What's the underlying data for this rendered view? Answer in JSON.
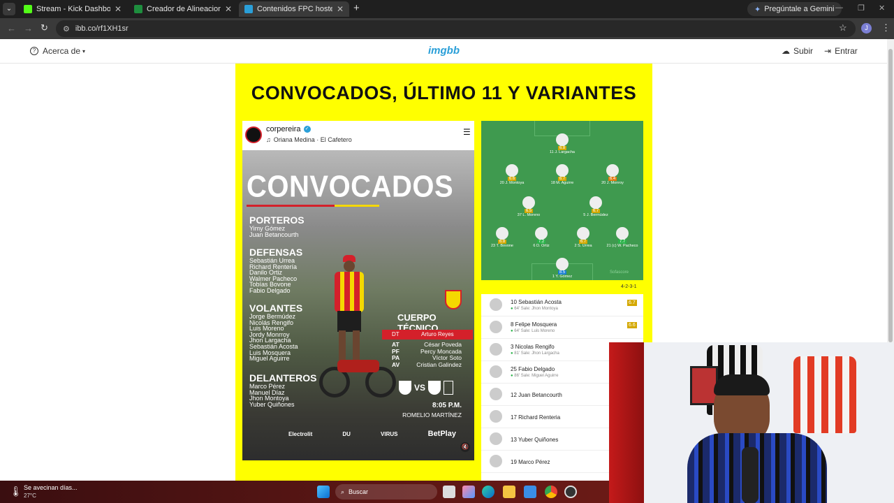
{
  "browser": {
    "tabs": [
      {
        "label": "Stream - Kick Dashboard",
        "favicon_color": "#53fc18"
      },
      {
        "label": "Creador de Alineaciones - Form",
        "favicon_color": "#1e8e3e"
      },
      {
        "label": "Contenidos FPC hosted at ImgB",
        "favicon_color": "#2a9fd8"
      }
    ],
    "gemini_label": "Pregúntale a Gemini",
    "url": "ibb.co/rf1XH1sr",
    "profile_initial": "J"
  },
  "imgbb_header": {
    "about_label": "Acerca de",
    "logo": "imgbb",
    "upload_label": "Subir",
    "login_label": "Entrar"
  },
  "poster": {
    "title": "CONVOCADOS, ÚLTIMO 11 Y VARIANTES",
    "ig": {
      "account": "corpereira",
      "music": "Oriana Medina · El Cafetero",
      "headline": "CONVOCADOS",
      "sections": [
        {
          "label": "PORTEROS",
          "players": [
            "Yimy Gómez",
            "Juan Betancourth"
          ]
        },
        {
          "label": "DEFENSAS",
          "players": [
            "Sebastián Urrea",
            "Richard Rentería",
            "Danilo Ortiz",
            "Walmer Pacheco",
            "Tobías Bovone",
            "Fabio Delgado"
          ]
        },
        {
          "label": "VOLANTES",
          "players": [
            "Jorge Bermúdez",
            "Nicolás Rengifo",
            "Luis Moreno",
            "Jordy Monrroy",
            "Jhon Largacha",
            "Sebastián Acosta",
            "Luis Mosquera",
            "Miguel Aguirre"
          ]
        },
        {
          "label": "DELANTEROS",
          "players": [
            "Marco Pérez",
            "Manuel Díaz",
            "Jhon Montoya",
            "Yuber Quiñones"
          ]
        }
      ],
      "staff": {
        "title": "CUERPO TÉCNICO",
        "dt_label": "DT",
        "dt_name": "Arturo Reyes",
        "roles": "AT\nPF\nPA\nAV",
        "names": "César Poveda\nPercy Moncada\nVíctor Soto\nCristian Galindez"
      },
      "match_vs": "VS",
      "match_time": "8:05 P.M.",
      "stadium": "ROMELIO MARTÍNEZ",
      "sponsors": [
        "Electrolit",
        "DU",
        "VIRUS",
        "BetPlay"
      ]
    },
    "formation": {
      "players": [
        {
          "name": "11 J. Largacha",
          "rating": "6.8",
          "color": "#d4a800"
        },
        {
          "name": "20 J. Montoya",
          "rating": "6.6",
          "color": "#d4a800"
        },
        {
          "name": "18 M. Aguirre",
          "rating": "6.7",
          "color": "#d4a800"
        },
        {
          "name": "20 J. Monroy",
          "rating": "6.4",
          "color": "#e07a10"
        },
        {
          "name": "37 L. Moreno",
          "rating": "6.5",
          "color": "#d4a800"
        },
        {
          "name": "5 J. Bermúdez",
          "rating": "6.7",
          "color": "#d4a800"
        },
        {
          "name": "23 T. Bovone",
          "rating": "6.8",
          "color": "#d4a800"
        },
        {
          "name": "6 D. Ortiz",
          "rating": "7.2",
          "color": "#2bb34a"
        },
        {
          "name": "2 S. Urrea",
          "rating": "6.7",
          "color": "#d4a800"
        },
        {
          "name": "21 (c) W. Pacheco",
          "rating": "7.7",
          "color": "#2bb34a"
        },
        {
          "name": "1 Y. Gómez",
          "rating": "8.5",
          "color": "#1a7fd4"
        }
      ],
      "watermark": "Sofascore",
      "system": "4-2-3-1"
    },
    "subs": [
      {
        "name": "10 Sebastián Acosta",
        "sub": "64' Sale: Jhon Montoya",
        "rating": "6.7"
      },
      {
        "name": "8 Felipe Mosquera",
        "sub": "64' Sale: Luis Moreno",
        "rating": "6.6"
      },
      {
        "name": "3 Nicolas Rengifo",
        "sub": "81' Sale: Jhon Largacha",
        "rating": ""
      },
      {
        "name": "25 Fabio Delgado",
        "sub": "86' Sale: Miguel Aguirre",
        "rating": ""
      },
      {
        "name": "12 Juan Betancourth",
        "sub": "",
        "rating": ""
      },
      {
        "name": "17 Richard Renteria",
        "sub": "",
        "rating": ""
      },
      {
        "name": "13 Yuber Quiñones",
        "sub": "",
        "rating": ""
      },
      {
        "name": "19 Marco Pérez",
        "sub": "",
        "rating": ""
      }
    ]
  },
  "taskbar": {
    "weather_text": "Se avecinan días...",
    "temperature": "27°C",
    "search_placeholder": "Buscar"
  }
}
